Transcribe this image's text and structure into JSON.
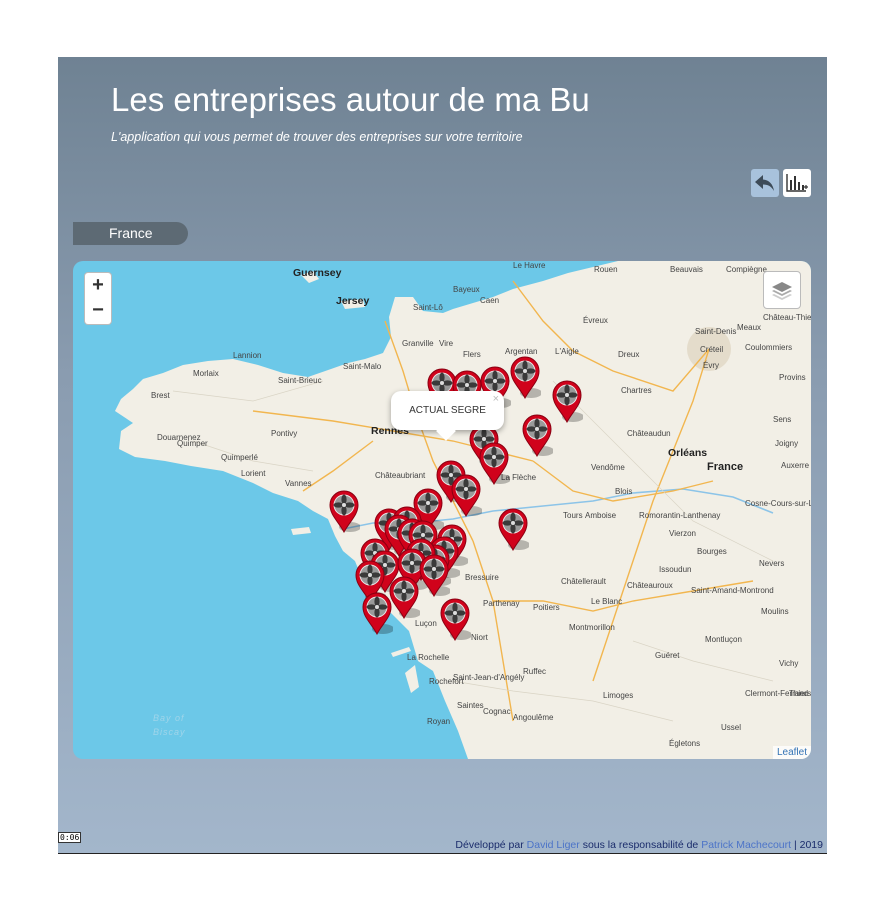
{
  "header": {
    "title": "Les entreprises autour de ma Bu",
    "subtitle": "L'application qui vous permet de trouver des entreprises sur votre territoire"
  },
  "toolbar": {
    "back_icon": "undo-arrow-icon",
    "chart_icon": "bar-chart-icon"
  },
  "location_tab": {
    "label": "France"
  },
  "map": {
    "zoom_in": "+",
    "zoom_out": "−",
    "layers_icon": "layers-icon",
    "attribution": "Leaflet",
    "popup": {
      "text": "ACTUAL SEGRE",
      "close": "×"
    },
    "places": {
      "guernsey": "Guernsey",
      "jersey": "Jersey",
      "saint_lo": "Saint-Lô",
      "caen": "Caen",
      "bayeux": "Bayeux",
      "rouen": "Rouen",
      "beauvais": "Beauvais",
      "compiegne": "Compiègne",
      "le_havre": "Le Havre",
      "evreux": "Évreux",
      "saint_denis": "Saint-Denis",
      "meaux": "Meaux",
      "creteil": "Créteil",
      "evry": "Évry",
      "chateau_thierry": "Château-Thierry",
      "coulommiers": "Coulommiers",
      "dreux": "Dreux",
      "chartres": "Chartres",
      "argentan": "Argentan",
      "laigle": "L'Aigle",
      "granville": "Granville",
      "vire": "Vire",
      "flers": "Flers",
      "saint_malo": "Saint-Malo",
      "saint_brieuc": "Saint-Brieuc",
      "lannion": "Lannion",
      "morlaix": "Morlaix",
      "brest": "Brest",
      "quimper": "Quimper",
      "lorient": "Lorient",
      "vannes": "Vannes",
      "rennes": "Rennes",
      "pontivy": "Pontivy",
      "quimperle": "Quimperlé",
      "douarnenez": "Douarnenez",
      "chateaubriant": "Châteaubriant",
      "la_fleche": "La Flèche",
      "vendome": "Vendôme",
      "orleans": "Orléans",
      "chateaudun": "Châteaudun",
      "france": "France",
      "blois": "Blois",
      "tours": "Tours",
      "amboise": "Amboise",
      "romorantin": "Romorantin-Lanthenay",
      "vierzon": "Vierzon",
      "bourges": "Bourges",
      "nevers": "Nevers",
      "issoudun": "Issoudun",
      "chateauroux": "Châteauroux",
      "saint_amand": "Saint-Amand-Montrond",
      "montlucon": "Montluçon",
      "moulins": "Moulins",
      "vichy": "Vichy",
      "clermont": "Clermont-Ferrand",
      "thiers": "Thiers",
      "gueret": "Guéret",
      "limoges": "Limoges",
      "ussel": "Ussel",
      "egletons": "Égletons",
      "poitiers": "Poitiers",
      "niort": "Niort",
      "parthenay": "Parthenay",
      "bressuire": "Bressuire",
      "chatellerault": "Châtellerault",
      "le_blanc": "Le Blanc",
      "montmorillon": "Montmorillon",
      "lucon": "Luçon",
      "la_rochelle": "La Rochelle",
      "rochefort": "Rochefort",
      "saintes": "Saintes",
      "cognac": "Cognac",
      "angouleme": "Angoulême",
      "royan": "Royan",
      "ruffec": "Ruffec",
      "saint_jean": "Saint-Jean-d'Angély",
      "cosne": "Cosne-Cours-sur-Loire",
      "auxerre": "Auxerre",
      "sens": "Sens",
      "joigny": "Joigny",
      "provins": "Provins",
      "bay_of": "Bay of",
      "biscay": "Biscay"
    }
  },
  "footer": {
    "prefix": "Développé par",
    "author": "David Liger",
    "middle": "sous la responsabilité de",
    "supervisor": "Patrick Machecourt",
    "suffix": "| 2019"
  },
  "video_time": "0:06",
  "colors": {
    "marker": "#d0021b",
    "sea": "#6cc8e8",
    "land": "#f2efe6"
  }
}
